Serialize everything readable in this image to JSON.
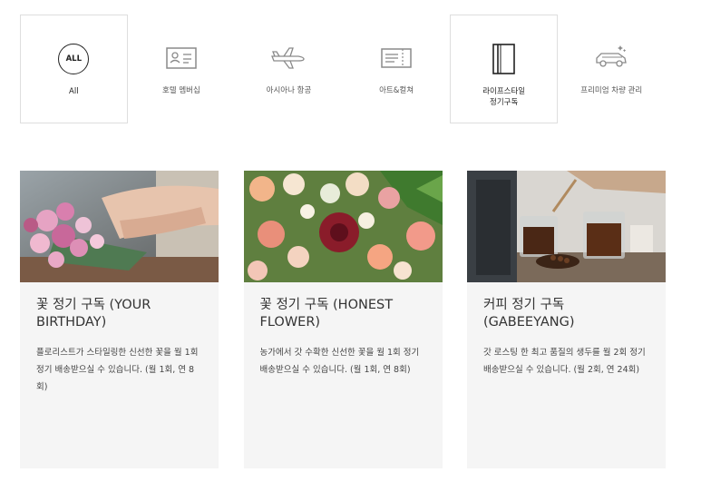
{
  "categories": [
    {
      "label": "All",
      "icon": "all-icon",
      "boxed": true
    },
    {
      "label": "호텔 멤버십",
      "icon": "membership-card-icon",
      "boxed": false
    },
    {
      "label": "아시아나 항공",
      "icon": "airplane-icon",
      "boxed": false
    },
    {
      "label": "아트&컬쳐",
      "icon": "ticket-icon",
      "boxed": false
    },
    {
      "label_line1": "라이프스타일",
      "label_line2": "정기구독",
      "icon": "book-icon",
      "boxed": true
    },
    {
      "label": "프리미엄 차량 관리",
      "icon": "car-icon",
      "boxed": false
    }
  ],
  "all_badge": "ALL",
  "cards": [
    {
      "title": "꽃 정기 구독 (YOUR BIRTHDAY)",
      "desc": "플로리스트가 스타일링한 신선한 꽃을 월 1회 정기 배송받으실 수 있습니다. (월 1회, 연 8회)",
      "image": "flower-arrangement-photo"
    },
    {
      "title": "꽃 정기 구독 (HONEST FLOWER)",
      "desc": "농가에서 갓 수확한 신선한 꽃을 월 1회 정기 배송받으실 수 있습니다. (월 1회, 연 8회)",
      "image": "flower-bouquet-photo"
    },
    {
      "title": "커피 정기 구독 (GABEEYANG)",
      "desc": "갓 로스팅 한 최고 품질의 생두를 월 2회 정기 배송받으실 수 있습니다. (월 2회, 연 24회)",
      "image": "coffee-photo"
    }
  ]
}
